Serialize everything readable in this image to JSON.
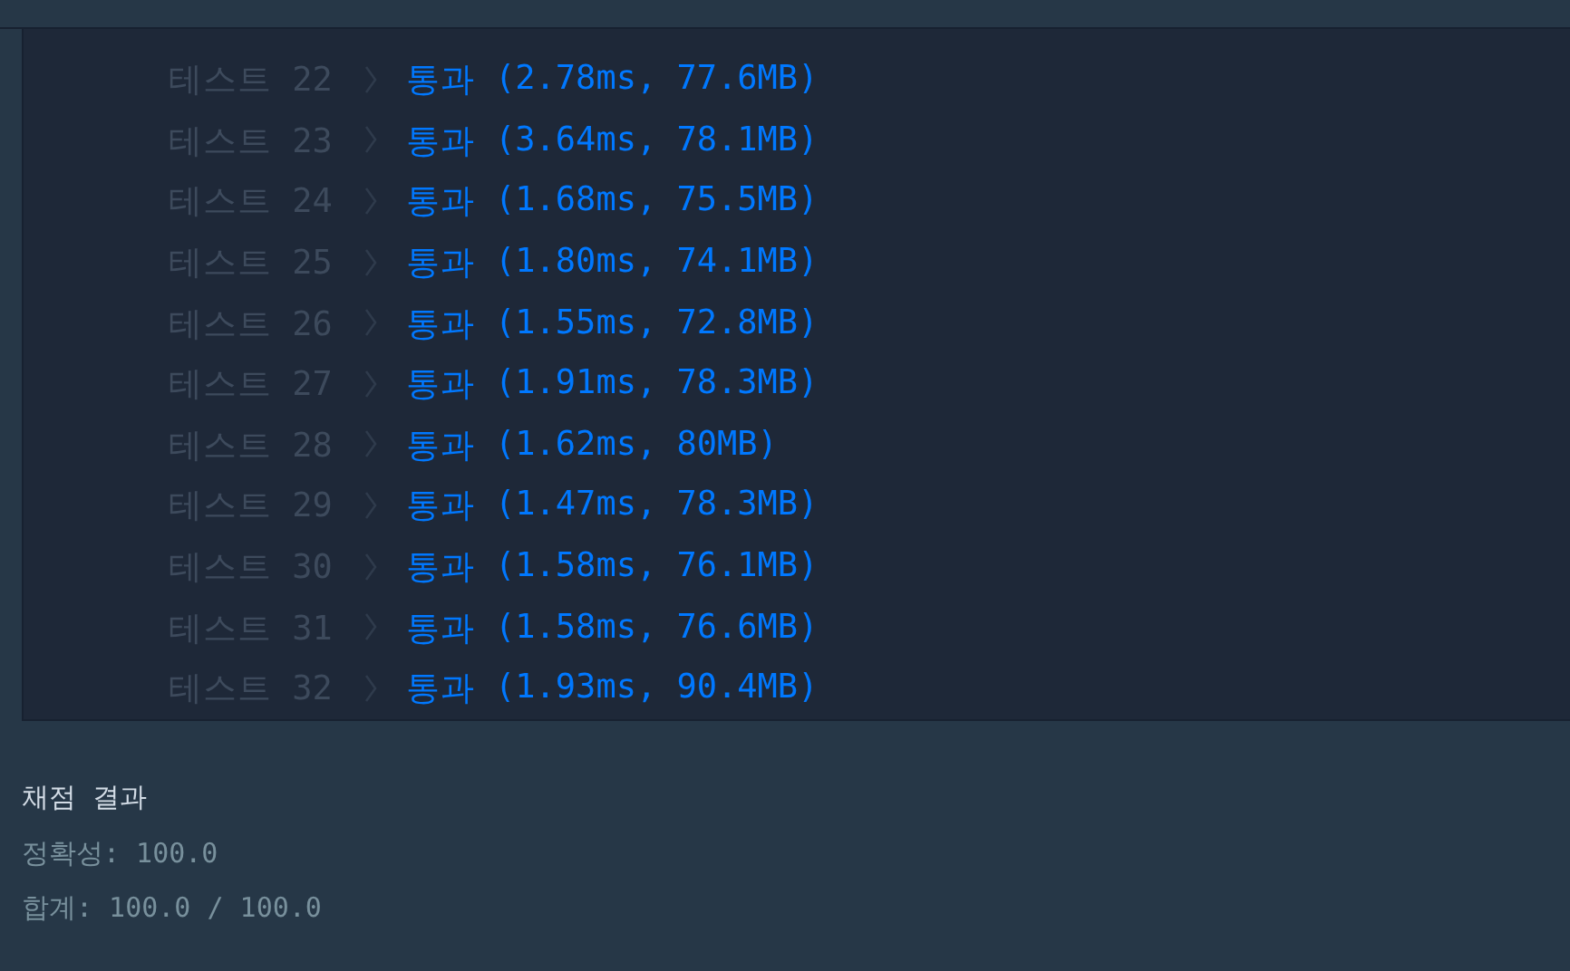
{
  "tests": [
    {
      "label": "테스트 22",
      "result": "통과",
      "passed": true,
      "detail": "(2.78ms, 77.6MB)"
    },
    {
      "label": "테스트 23",
      "result": "통과",
      "passed": true,
      "detail": "(3.64ms, 78.1MB)"
    },
    {
      "label": "테스트 24",
      "result": "통과",
      "passed": true,
      "detail": "(1.68ms, 75.5MB)"
    },
    {
      "label": "테스트 25",
      "result": "통과",
      "passed": true,
      "detail": "(1.80ms, 74.1MB)"
    },
    {
      "label": "테스트 26",
      "result": "통과",
      "passed": true,
      "detail": "(1.55ms, 72.8MB)"
    },
    {
      "label": "테스트 27",
      "result": "통과",
      "passed": true,
      "detail": "(1.91ms, 78.3MB)"
    },
    {
      "label": "테스트 28",
      "result": "통과",
      "passed": true,
      "detail": "(1.62ms, 80MB)"
    },
    {
      "label": "테스트 29",
      "result": "통과",
      "passed": true,
      "detail": "(1.47ms, 78.3MB)"
    },
    {
      "label": "테스트 30",
      "result": "통과",
      "passed": true,
      "detail": "(1.58ms, 76.1MB)"
    },
    {
      "label": "테스트 31",
      "result": "통과",
      "passed": true,
      "detail": "(1.58ms, 76.6MB)"
    },
    {
      "label": "테스트 32",
      "result": "통과",
      "passed": true,
      "detail": "(1.93ms, 90.4MB)"
    }
  ],
  "summary": {
    "title": "채점 결과",
    "lines": [
      "정확성: 100.0",
      "합계: 100.0 / 100.0"
    ]
  }
}
